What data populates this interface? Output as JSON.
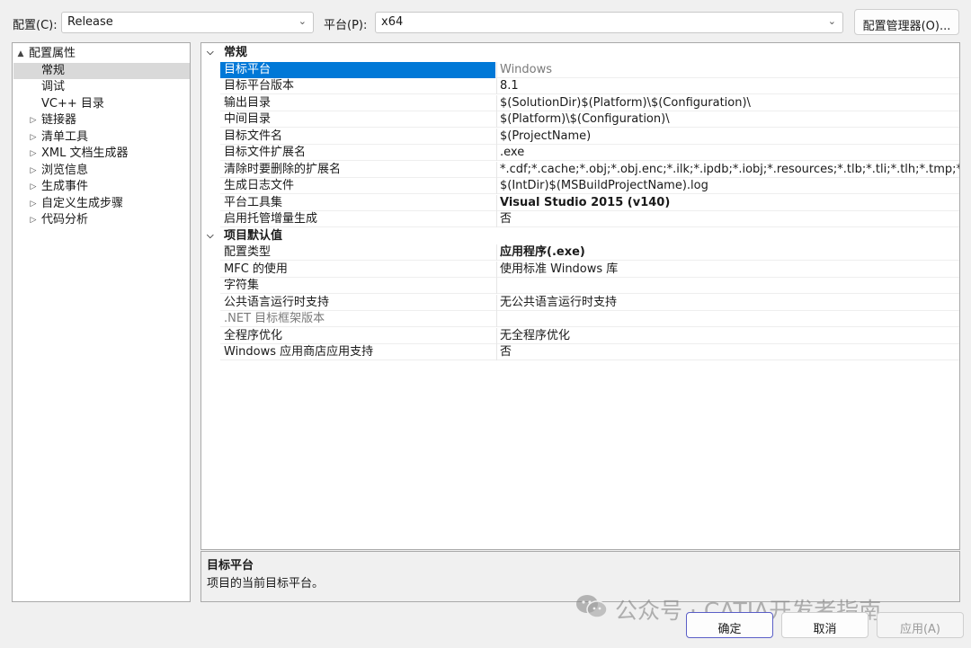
{
  "toolbar": {
    "config_label": "配置(C):",
    "config_value": "Release",
    "platform_label": "平台(P):",
    "platform_value": "x64",
    "config_manager_button": "配置管理器(O)..."
  },
  "tree": {
    "items": [
      {
        "label": "配置属性",
        "expander": "▲",
        "level": 0,
        "selected": false
      },
      {
        "label": "常规",
        "expander": "",
        "level": 1,
        "selected": true
      },
      {
        "label": "调试",
        "expander": "",
        "level": 1,
        "selected": false
      },
      {
        "label": "VC++ 目录",
        "expander": "",
        "level": 1,
        "selected": false
      },
      {
        "label": "链接器",
        "expander": "▷",
        "level": 1,
        "selected": false
      },
      {
        "label": "清单工具",
        "expander": "▷",
        "level": 1,
        "selected": false
      },
      {
        "label": "XML 文档生成器",
        "expander": "▷",
        "level": 1,
        "selected": false
      },
      {
        "label": "浏览信息",
        "expander": "▷",
        "level": 1,
        "selected": false
      },
      {
        "label": "生成事件",
        "expander": "▷",
        "level": 1,
        "selected": false
      },
      {
        "label": "自定义生成步骤",
        "expander": "▷",
        "level": 1,
        "selected": false
      },
      {
        "label": "代码分析",
        "expander": "▷",
        "level": 1,
        "selected": false
      }
    ]
  },
  "grid": {
    "categories": [
      {
        "title": "常规",
        "caret": "⌵",
        "rows": [
          {
            "name": "目标平台",
            "value": "Windows",
            "selected": true,
            "value_grey": true
          },
          {
            "name": "目标平台版本",
            "value": "8.1"
          },
          {
            "name": "输出目录",
            "value": "$(SolutionDir)$(Platform)\\$(Configuration)\\"
          },
          {
            "name": "中间目录",
            "value": "$(Platform)\\$(Configuration)\\"
          },
          {
            "name": "目标文件名",
            "value": "$(ProjectName)"
          },
          {
            "name": "目标文件扩展名",
            "value": ".exe"
          },
          {
            "name": "清除时要删除的扩展名",
            "value": "*.cdf;*.cache;*.obj;*.obj.enc;*.ilk;*.ipdb;*.iobj;*.resources;*.tlb;*.tli;*.tlh;*.tmp;*.rsp;*.pgc;"
          },
          {
            "name": "生成日志文件",
            "value": "$(IntDir)$(MSBuildProjectName).log"
          },
          {
            "name": "平台工具集",
            "value": "Visual Studio 2015 (v140)",
            "bold": true
          },
          {
            "name": "启用托管增量生成",
            "value": "否"
          }
        ]
      },
      {
        "title": "项目默认值",
        "caret": "⌵",
        "rows": [
          {
            "name": "配置类型",
            "value": "应用程序(.exe)",
            "bold": true
          },
          {
            "name": "MFC 的使用",
            "value": "使用标准 Windows 库"
          },
          {
            "name": "字符集",
            "value": ""
          },
          {
            "name": "公共语言运行时支持",
            "value": "无公共语言运行时支持"
          },
          {
            "name": ".NET 目标框架版本",
            "value": "",
            "name_grey": true
          },
          {
            "name": "全程序优化",
            "value": "无全程序优化"
          },
          {
            "name": "Windows 应用商店应用支持",
            "value": "否"
          }
        ]
      }
    ]
  },
  "description": {
    "title": "目标平台",
    "text": "项目的当前目标平台。"
  },
  "buttons": {
    "ok": "确定",
    "cancel": "取消",
    "apply": "应用(A)"
  },
  "watermark": {
    "text": "公众号 · CATIA开发者指南",
    "icon": "wechat-icon"
  },
  "colors": {
    "selection": "#0078d7",
    "tree_selection": "#d9d9d9",
    "ok_border": "#5b5fc7"
  }
}
